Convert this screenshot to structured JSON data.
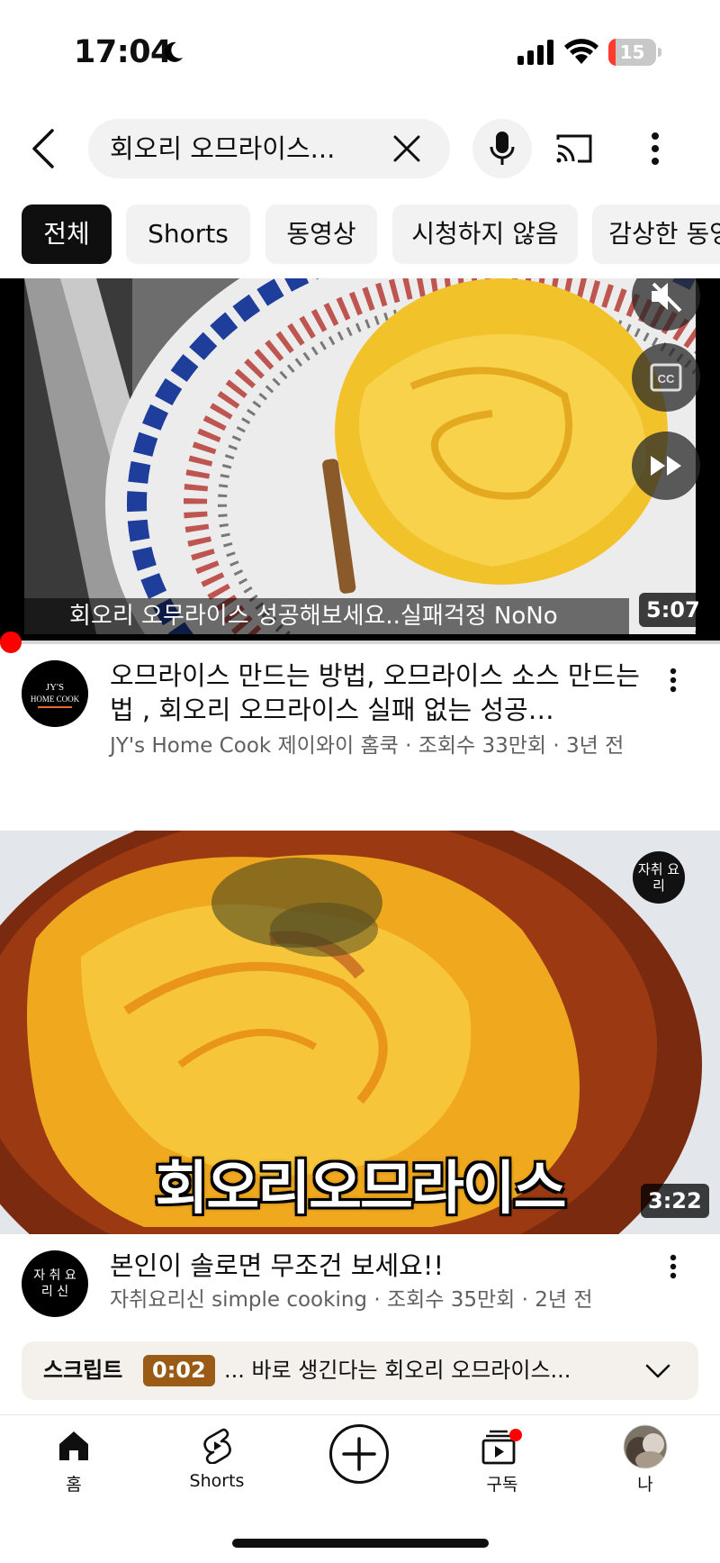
{
  "status_bar": {
    "time": "17:04",
    "battery_level": "15",
    "battery_fraction": 0.15
  },
  "search": {
    "query": "회오리 오므라이스..."
  },
  "chips": [
    "전체",
    "Shorts",
    "동영상",
    "시청하지 않음",
    "감상한 동영상"
  ],
  "videos": [
    {
      "thumbnail_caption": "회오리 오무라이스 성공해보세요..실패걱정 NoNo",
      "duration": "5:07",
      "progress_fraction": 0.015,
      "avatar_text": "JY'S HOME COOK",
      "title": "오므라이스 만드는 방법, 오므라이스 소스 만드는법 , 회오리 오므라이스 실패 없는 성공…",
      "subtitle": "JY's Home Cook 제이와이 홈쿡 · 조회수 33만회 · 3년 전"
    },
    {
      "overlay_title": "회오리오므라이스",
      "channel_badge": "자취 요리",
      "duration": "3:22",
      "avatar_text": "자 취 요 리 신",
      "title": "본인이 솔로면 무조건 보세요!!",
      "subtitle": "자취요리신 simple cooking · 조회수 35만회 · 2년 전"
    }
  ],
  "transcript": {
    "label": "스크립트",
    "time": "0:02",
    "text": "... 바로 생긴다는 회오리 오므라이스..."
  },
  "nav": {
    "home": "홈",
    "shorts": "Shorts",
    "subscriptions": "구독",
    "you": "나"
  },
  "colors": {
    "accent_red": "#ff0000",
    "chip_active_bg": "#0f0f0f",
    "chip_bg": "#f2f2f2",
    "transcript_time_bg": "#9a5b16"
  }
}
